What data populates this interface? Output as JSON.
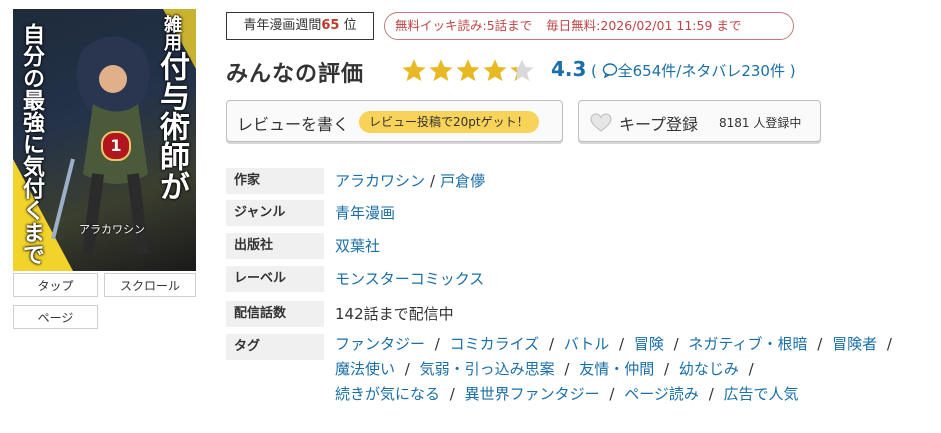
{
  "cover": {
    "title_small": "雑用",
    "title_main": "付与術師が",
    "title_left": "自分の最強に気付くまで",
    "volume": "1",
    "author": "アラカワシン"
  },
  "view_buttons": [
    "タップ",
    "スクロール",
    "ページ"
  ],
  "ranking": {
    "prefix": "青年漫画週間",
    "rank": "65",
    "suffix": "位"
  },
  "free_info": {
    "ikki": "無料イッキ読み:5話まで",
    "daily": "毎日無料:2026/02/01 11:59 まで"
  },
  "rating": {
    "title": "みんなの評価",
    "score": "4.3",
    "stars": 4.3,
    "count_text": "全654件/ネタバレ230件",
    "open_paren": "(",
    "close_paren": ")"
  },
  "review_button": {
    "label": "レビューを書く",
    "badge": "レビュー投稿で20ptゲット！"
  },
  "keep_button": {
    "label": "キープ登録",
    "count": "8181 人登録中"
  },
  "info": {
    "author_label": "作家",
    "authors": [
      "アラカワシン",
      "戸倉儚"
    ],
    "genre_label": "ジャンル",
    "genre": "青年漫画",
    "publisher_label": "出版社",
    "publisher": "双葉社",
    "label_label": "レーベル",
    "label": "モンスターコミックス",
    "episodes_label": "配信話数",
    "episodes": "142話まで配信中",
    "tags_label": "タグ",
    "tags_line1": [
      "ファンタジー",
      "コミカライズ",
      "バトル",
      "冒険",
      "ネガティブ・根暗",
      "冒険者"
    ],
    "tags_line2": [
      "魔法使い",
      "気弱・引っ込み思案",
      "友情・仲間",
      "幼なじみ"
    ],
    "tags_line3": [
      "続きが気になる",
      "異世界ファンタジー",
      "ページ読み",
      "広告で人気"
    ]
  },
  "colors": {
    "link": "#1a6fa8",
    "rank": "#c0392b",
    "free": "#c04545",
    "badge": "#f7d35a",
    "star": "#e8b923"
  }
}
